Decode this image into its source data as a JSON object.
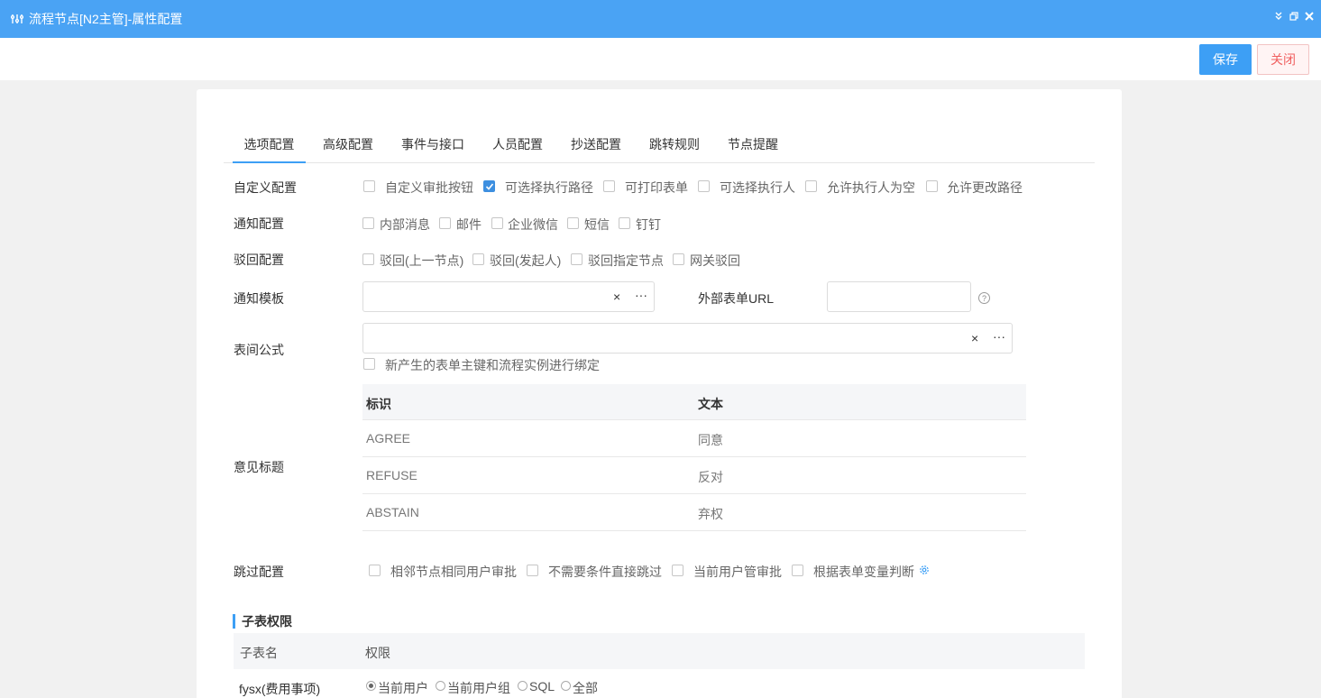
{
  "window": {
    "title": "流程节点[N2主管]-属性配置",
    "icon": "workflow-icon"
  },
  "toolbar": {
    "save_label": "保存",
    "close_label": "关闭"
  },
  "tabs": [
    {
      "label": "选项配置",
      "active": true
    },
    {
      "label": "高级配置",
      "active": false
    },
    {
      "label": "事件与接口",
      "active": false
    },
    {
      "label": "人员配置",
      "active": false
    },
    {
      "label": "抄送配置",
      "active": false
    },
    {
      "label": "跳转规则",
      "active": false
    },
    {
      "label": "节点提醒",
      "active": false
    }
  ],
  "custom_config": {
    "label": "自定义配置",
    "options": [
      {
        "label": "自定义审批按钮",
        "checked": false
      },
      {
        "label": "可选择执行路径",
        "checked": true
      },
      {
        "label": "可打印表单",
        "checked": false
      },
      {
        "label": "可选择执行人",
        "checked": false
      },
      {
        "label": "允许执行人为空",
        "checked": false
      },
      {
        "label": "允许更改路径",
        "checked": false
      }
    ]
  },
  "notify_config": {
    "label": "通知配置",
    "options": [
      {
        "label": "内部消息",
        "checked": false
      },
      {
        "label": "邮件",
        "checked": false
      },
      {
        "label": "企业微信",
        "checked": false
      },
      {
        "label": "短信",
        "checked": false
      },
      {
        "label": "钉钉",
        "checked": false
      }
    ]
  },
  "reject_config": {
    "label": "驳回配置",
    "options": [
      {
        "label": "驳回(上一节点)",
        "checked": false
      },
      {
        "label": "驳回(发起人)",
        "checked": false
      },
      {
        "label": "驳回指定节点",
        "checked": false
      },
      {
        "label": "网关驳回",
        "checked": false
      }
    ]
  },
  "notify_template": {
    "label": "通知模板",
    "value": "",
    "clear": "×",
    "more": "···"
  },
  "external_url": {
    "label": "外部表单URL",
    "value": "",
    "help": "?"
  },
  "form_formula": {
    "label": "表间公式",
    "value": "",
    "clear": "×",
    "more": "···",
    "bind_option": {
      "label": "新产生的表单主键和流程实例进行绑定",
      "checked": false
    }
  },
  "opinion": {
    "label": "意见标题",
    "headers": [
      "标识",
      "文本"
    ],
    "rows": [
      [
        "AGREE",
        "同意"
      ],
      [
        "REFUSE",
        "反对"
      ],
      [
        "ABSTAIN",
        "弃权"
      ]
    ]
  },
  "skip_config": {
    "label": "跳过配置",
    "options": [
      {
        "label": "相邻节点相同用户审批",
        "checked": false
      },
      {
        "label": "不需要条件直接跳过",
        "checked": false
      },
      {
        "label": "当前用户管审批",
        "checked": false
      },
      {
        "label": "根据表单变量判断",
        "checked": false
      }
    ],
    "settings_icon": "gear-icon"
  },
  "subtable": {
    "section_title": "子表权限",
    "headers": [
      "子表名",
      "权限"
    ],
    "rows": [
      {
        "name": "fysx(费用事项)",
        "options": [
          {
            "label": "当前用户",
            "selected": true
          },
          {
            "label": "当前用户组",
            "selected": false
          },
          {
            "label": "SQL",
            "selected": false
          },
          {
            "label": "全部",
            "selected": false
          }
        ]
      }
    ]
  }
}
